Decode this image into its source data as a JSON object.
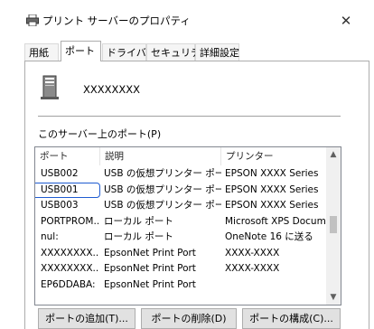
{
  "window": {
    "title": "プリント サーバーのプロパティ",
    "close_glyph": "✕"
  },
  "tabs": [
    "用紙",
    "ポート",
    "ドライバー",
    "セキュリティ",
    "詳細設定"
  ],
  "active_tab": "ポート",
  "server_name": "XXXXXXXX",
  "ports_label": "このサーバー上のポート(P)",
  "ports_table": {
    "headers": [
      "ポート",
      "説明",
      "プリンター"
    ],
    "rows": [
      [
        "USB002",
        "USB の仮想プリンター ポート",
        "EPSON XXXX Series"
      ],
      [
        "USB001",
        "USB の仮想プリンター ポート",
        "EPSON XXXX Series"
      ],
      [
        "USB003",
        "USB の仮想プリンター ポート",
        "EPSON XXXX Series"
      ],
      [
        "PORTPROM...",
        "ローカル ポート",
        "Microsoft XPS Documen"
      ],
      [
        "nul:",
        "ローカル ポート",
        "OneNote 16 に送る"
      ],
      [
        "XXXXXXXX...",
        "EpsonNet Print Port",
        "XXXX-XXXX"
      ],
      [
        "XXXXXXXX...",
        "EpsonNet Print Port",
        "XXXX-XXXX"
      ],
      [
        "EP6DDABA:",
        "EpsonNet Print Port",
        ""
      ]
    ]
  },
  "buttons": {
    "add": "ポートの追加(T)...",
    "delete": "ポートの削除(D)",
    "configure": "ポートの構成(C)..."
  },
  "colors": {
    "selection_outline": "#1f5cd1"
  },
  "icons": {
    "title": "printer-icon",
    "server": "server-tower-icon"
  }
}
